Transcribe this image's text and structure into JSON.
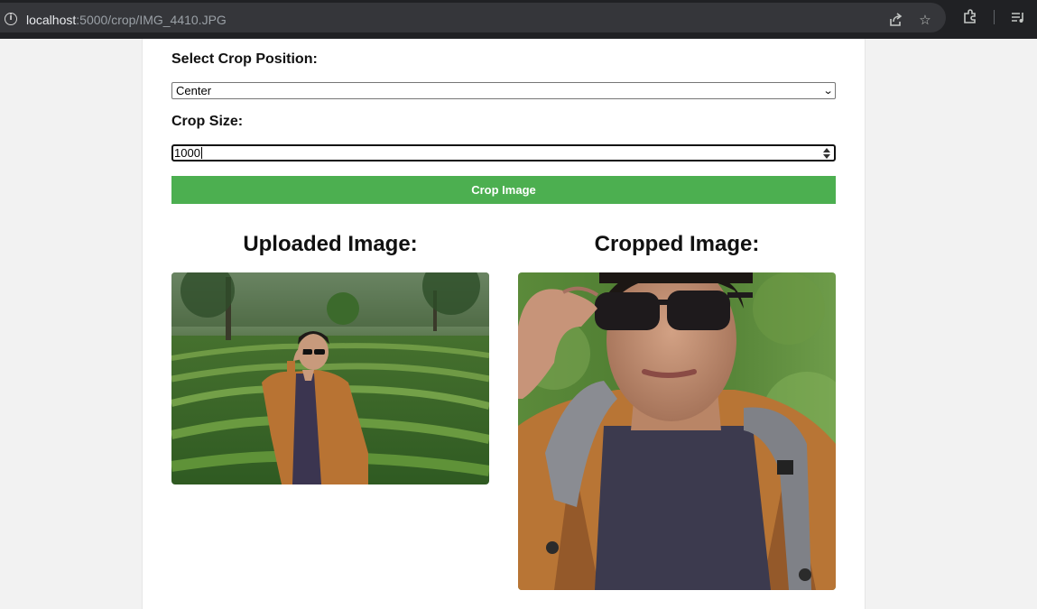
{
  "browser": {
    "url_host": "localhost",
    "url_path": ":5000/crop/IMG_4410.JPG",
    "icons": [
      "info-icon",
      "share-icon",
      "star-icon",
      "extensions-icon",
      "reading-list-icon"
    ]
  },
  "form": {
    "position_label": "Select Crop Position:",
    "position_value": "Center",
    "size_label": "Crop Size:",
    "size_value": "1000",
    "submit_label": "Crop Image"
  },
  "results": {
    "uploaded_heading": "Uploaded Image:",
    "cropped_heading": "Cropped Image:"
  },
  "colors": {
    "button": "#4caf50",
    "page_background": "#f2f2f2"
  }
}
